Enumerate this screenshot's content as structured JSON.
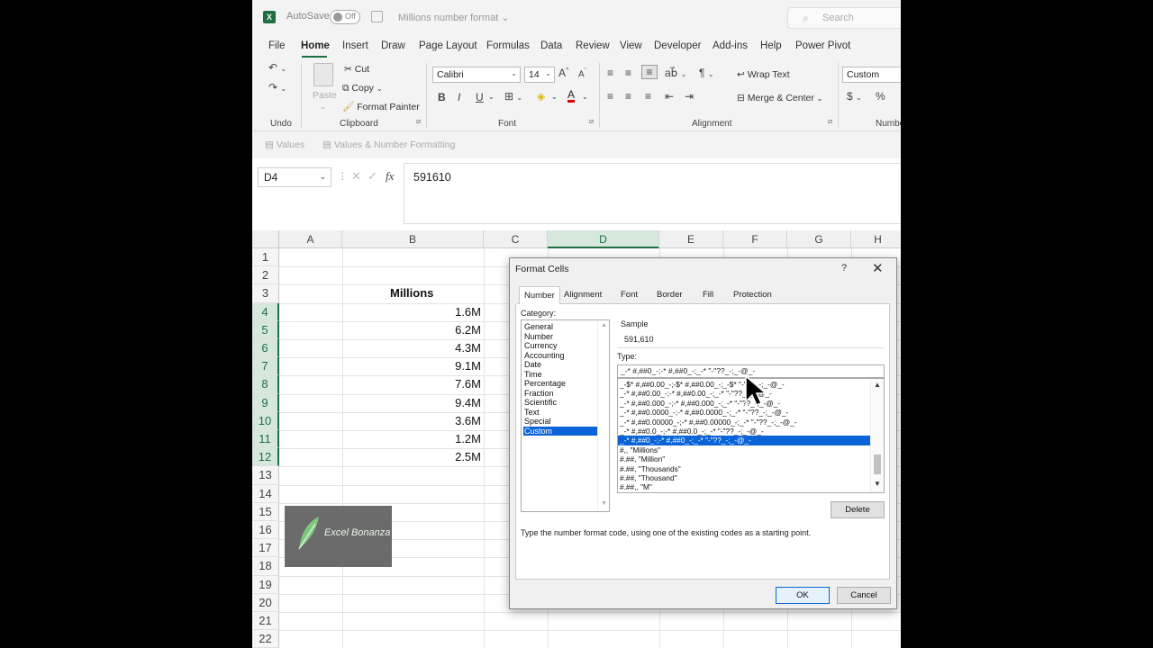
{
  "titlebar": {
    "app_logo": "X",
    "autosave_label": "AutoSave",
    "autosave_state": "Off",
    "doc_title": "Millions number format",
    "search_placeholder": "Search"
  },
  "menu": [
    "File",
    "Home",
    "Insert",
    "Draw",
    "Page Layout",
    "Formulas",
    "Data",
    "Review",
    "View",
    "Developer",
    "Add-ins",
    "Help",
    "Power Pivot"
  ],
  "ribbon": {
    "undo_group": "Undo",
    "paste_label": "Paste",
    "cut_label": "Cut",
    "copy_label": "Copy",
    "format_painter_label": "Format Painter",
    "clipboard_group": "Clipboard",
    "font_name": "Calibri",
    "font_size": "14",
    "font_group": "Font",
    "wrap_text_label": "Wrap Text",
    "merge_center_label": "Merge & Center",
    "alignment_group": "Alignment",
    "number_format": "Custom",
    "number_group": "Number"
  },
  "pastebar": {
    "values_label": "Values",
    "values_number_label": "Values & Number Formatting"
  },
  "formula": {
    "name_box": "D4",
    "value": "591610"
  },
  "sheet": {
    "columns": [
      "A",
      "B",
      "C",
      "D",
      "E",
      "F",
      "G",
      "H"
    ],
    "rows": [
      "1",
      "2",
      "3",
      "4",
      "5",
      "6",
      "7",
      "8",
      "9",
      "10",
      "11",
      "12",
      "13",
      "14",
      "15",
      "16",
      "17",
      "18",
      "19",
      "20",
      "21",
      "22"
    ],
    "header_text": "Millions",
    "values": [
      "1.6M",
      "6.2M",
      "4.3M",
      "9.1M",
      "7.6M",
      "9.4M",
      "3.6M",
      "1.2M",
      "2.5M"
    ],
    "logo_text": "Excel Bonanza"
  },
  "dialog": {
    "title": "Format Cells",
    "help": "?",
    "close": "✕",
    "tabs": [
      "Number",
      "Alignment",
      "Font",
      "Border",
      "Fill",
      "Protection"
    ],
    "category_label": "Category:",
    "categories": [
      "General",
      "Number",
      "Currency",
      "Accounting",
      "Date",
      "Time",
      "Percentage",
      "Fraction",
      "Scientific",
      "Text",
      "Special",
      "Custom"
    ],
    "selected_category": "Custom",
    "sample_label": "Sample",
    "sample_value": "591,610",
    "type_label": "Type:",
    "type_value": "_-* #,##0_-;-* #,##0_-;_-* \"-\"??_-;_-@_-",
    "type_list": [
      "_-$* #,##0.00_-;-$* #,##0.00_-;_-$* \"-\"??_-;_-@_-",
      "_-* #,##0.00_-;-* #,##0.00_-;_-* \"-\"??_-;_-@_-",
      "_-* #,##0.000_-;-* #,##0.000_-;_-* \"-\"??_-;_-@_-",
      "_-* #,##0.0000_-;-* #,##0.0000_-;_-* \"-\"??_-;_-@_-",
      "_-* #,##0.00000_-;-* #,##0.00000_-;_-* \"-\"??_-;_-@_-",
      "_-* #,##0.0_-;-* #,##0.0_-;_-* \"-\"??_-;_-@_-",
      "_-* #,##0_-;-* #,##0_-;_-* \"-\"??_-;_-@_-",
      "#,, \"Millions\"",
      "#.##, \"Million\"",
      "#.##, \"Thousands\"",
      "#.##, \"Thousand\"",
      "#.##,, \"M\""
    ],
    "selected_type_index": 6,
    "delete_label": "Delete",
    "hint": "Type the number format code, using one of the existing codes as a starting point.",
    "ok_label": "OK",
    "cancel_label": "Cancel"
  },
  "colors": {
    "excel_green": "#1d6f42",
    "selection_blue": "#0a64d8"
  }
}
